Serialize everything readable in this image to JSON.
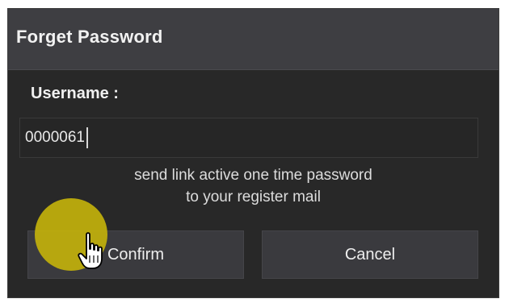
{
  "dialog": {
    "title": "Forget Password",
    "username_label": "Username :",
    "username_value": "0000061",
    "hint_line_1": "send link active one time password",
    "hint_line_2": "to your register mail",
    "confirm_label": "Confirm",
    "cancel_label": "Cancel"
  },
  "colors": {
    "dialog_background": "#282828",
    "titlebar_background": "#3e3e42",
    "button_background": "#3a3a3e",
    "cursor_highlight": "#c5b40a"
  },
  "icons": {
    "pointer": "hand-pointer-icon"
  }
}
